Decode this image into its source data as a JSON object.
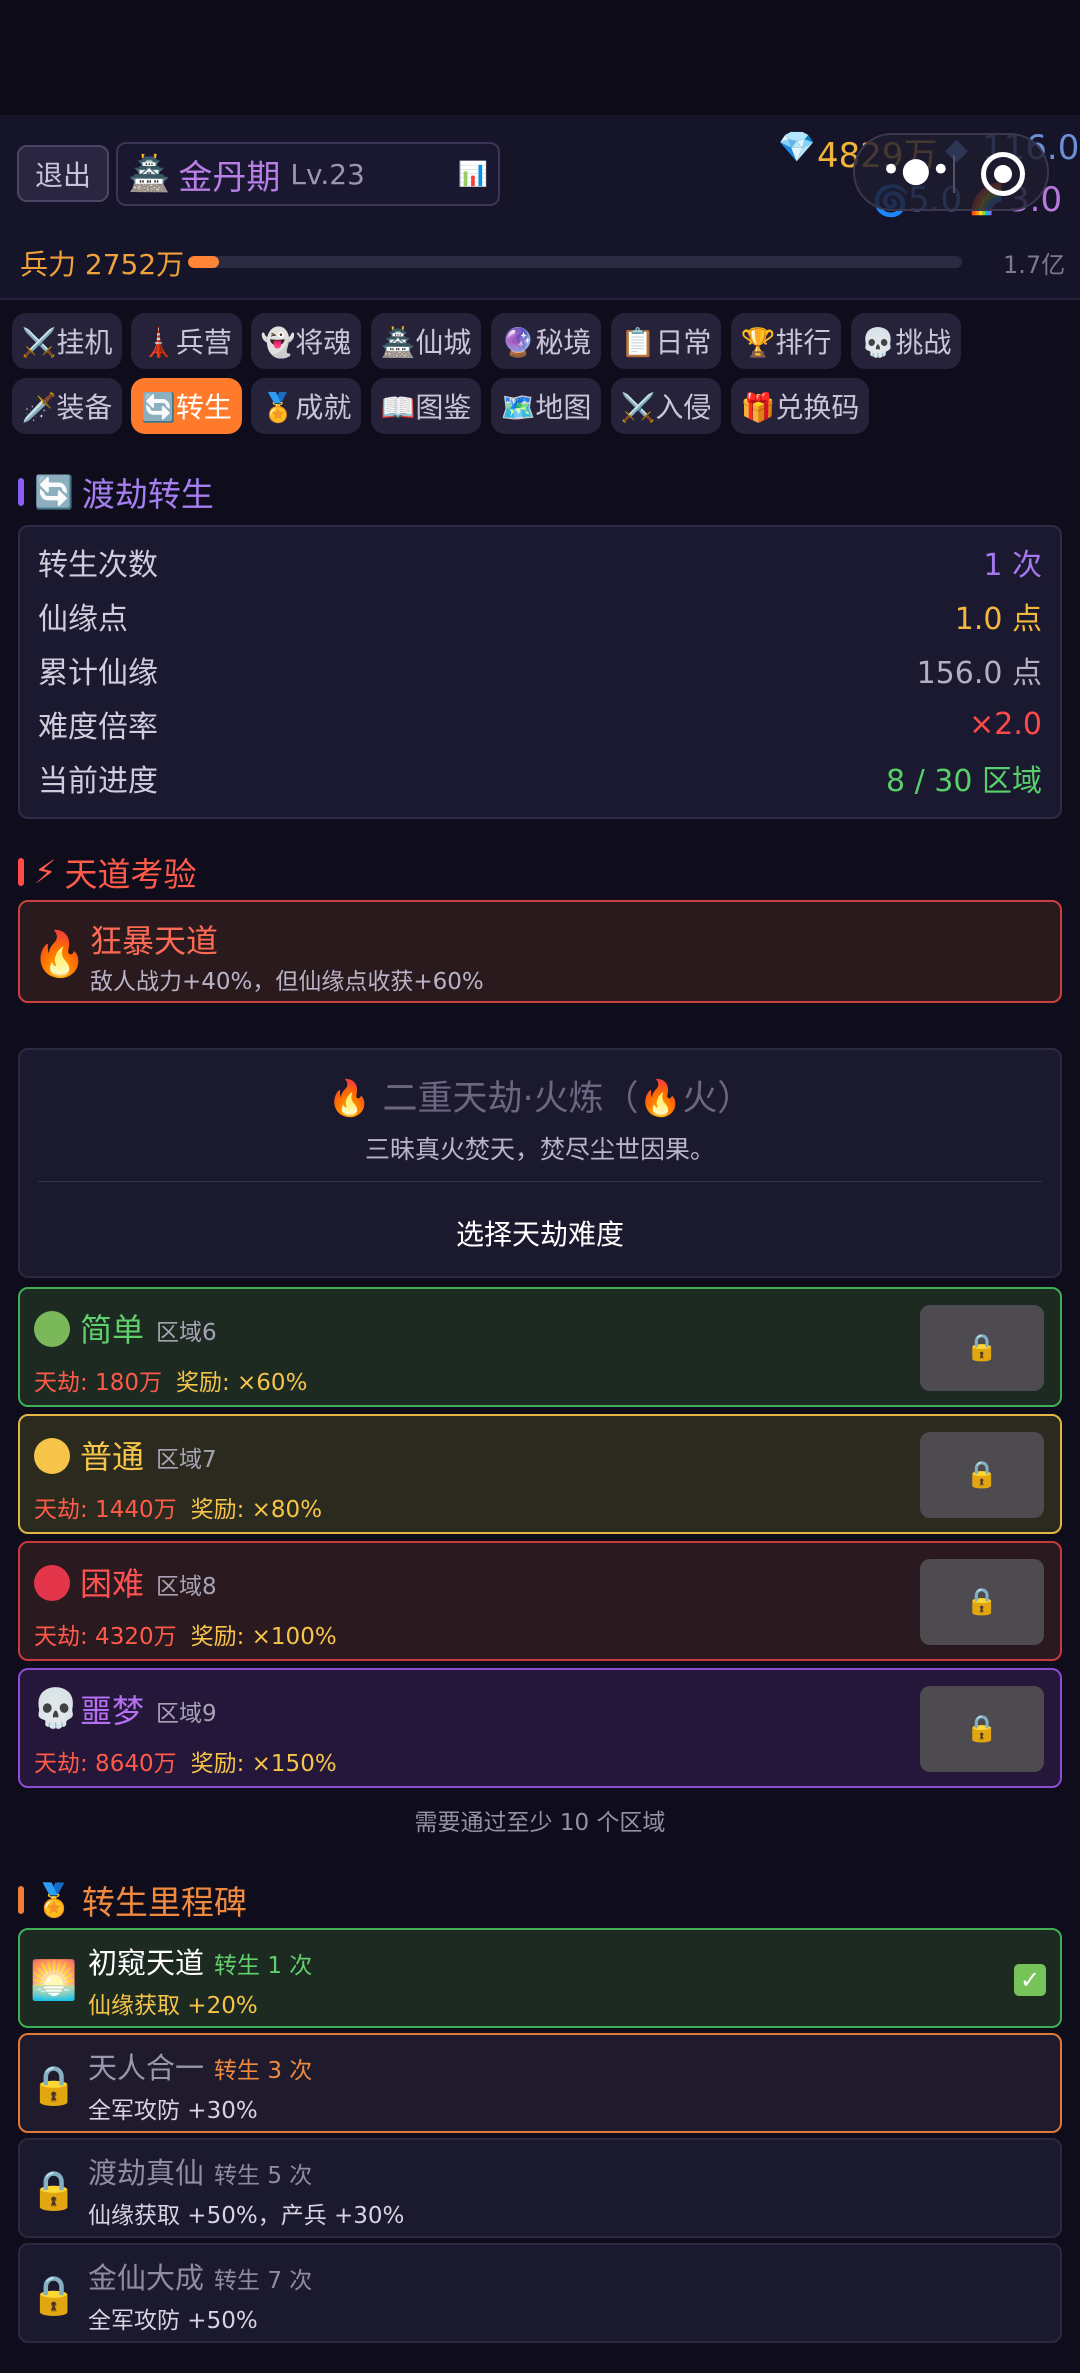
{
  "header": {
    "exit_label": "退出",
    "realm_name": "金丹期",
    "realm_level": "Lv.23",
    "gold": "4829万",
    "crystal": "116.0",
    "swirl": "5.0",
    "rainbow": "3.0",
    "power_label": "兵力 2752万",
    "power_fraction": 0.04,
    "power_max": "1.7亿"
  },
  "tabs_row1": [
    {
      "label": "⚔️挂机"
    },
    {
      "label": "🗼兵营"
    },
    {
      "label": "👻将魂"
    },
    {
      "label": "🏯仙城"
    },
    {
      "label": "🔮秘境",
      "dot": true
    },
    {
      "label": "📋日常"
    },
    {
      "label": "🏆排行"
    },
    {
      "label": "💀挑战",
      "dot": true
    }
  ],
  "tabs_row2": [
    {
      "label": "🗡️装备"
    },
    {
      "label": "🔄转生",
      "active": true
    },
    {
      "label": "🏅成就"
    },
    {
      "label": "📖图鉴"
    },
    {
      "label": "🗺️地图"
    },
    {
      "label": "⚔️入侵"
    },
    {
      "label": "🎁兑换码"
    }
  ],
  "rebirth": {
    "title": "渡劫转生",
    "rows": [
      {
        "key": "转生次数",
        "value": "1 次",
        "color": "#a678f0"
      },
      {
        "key": "仙缘点",
        "value": "1.0 点",
        "color": "#f5b73b"
      },
      {
        "key": "累计仙缘",
        "value": "156.0 点",
        "color": "#b3afc2"
      },
      {
        "key": "难度倍率",
        "value": "×2.0",
        "color": "#ff4a4a"
      },
      {
        "key": "当前进度",
        "value": "8 / 30 区域",
        "color": "#58d06a"
      }
    ]
  },
  "trial": {
    "title": "天道考验",
    "name": "狂暴天道",
    "desc": "敌人战力+40%，但仙缘点收获+60%"
  },
  "calamity": {
    "title": "🔥 二重天劫·火炼（🔥火）",
    "subtitle": "三昧真火焚天，焚尽尘世因果。",
    "choose_label": "选择天劫难度"
  },
  "difficulties": [
    {
      "name": "简单",
      "zone": "区域6",
      "tianjie": "天劫: 180万",
      "reward": "奖励: ×60%",
      "border": "#3fae55",
      "bg": "#1c2a22",
      "color": "#5fd06b",
      "dot": "#7bb85a"
    },
    {
      "name": "普通",
      "zone": "区域7",
      "tianjie": "天劫: 1440万",
      "reward": "奖励: ×80%",
      "border": "#e1b643",
      "bg": "#2b2a1e",
      "color": "#f6c448",
      "dot": "#f6c448"
    },
    {
      "name": "困难",
      "zone": "区域8",
      "tianjie": "天劫: 4320万",
      "reward": "奖励: ×100%",
      "border": "#c73b3f",
      "bg": "#2a1a20",
      "color": "#ff5252",
      "dot": "#e4364a"
    },
    {
      "name": "噩梦",
      "zone": "区域9",
      "tianjie": "天劫: 8640万",
      "reward": "奖励: ×150%",
      "border": "#8a4ed1",
      "bg": "#24173a",
      "color": "#b470f0",
      "skull": "💀"
    }
  ],
  "lock_icon": "🔒",
  "requirement": "需要通过至少 10 个区域",
  "milestones": {
    "title": "转生里程碑",
    "items": [
      {
        "icon": "🌅",
        "name": "初窥天道",
        "times": "转生 1 次",
        "desc": "仙缘获取 +20%",
        "done": true,
        "border": "#3fae55",
        "bg": "#1c2a22",
        "ncolor": "#ffffff",
        "tcolor": "#5fd06b",
        "dcolor": "#f6c448"
      },
      {
        "icon": "🔒",
        "name": "天人合一",
        "times": "转生 3 次",
        "desc": "全军攻防 +30%",
        "done": false,
        "border": "#e07a3a",
        "bg": "#1f1a2c",
        "ncolor": "#9a96ad",
        "tcolor": "#f08a3e",
        "dcolor": "#d7d3e2"
      },
      {
        "icon": "🔒",
        "name": "渡劫真仙",
        "times": "转生 5 次",
        "desc": "仙缘获取 +50%，产兵 +30%",
        "done": false,
        "border": "#2c2942",
        "bg": "#1b192e",
        "ncolor": "#8f8ba3",
        "tcolor": "#8f8ba3",
        "dcolor": "#d7d3e2"
      },
      {
        "icon": "🔒",
        "name": "金仙大成",
        "times": "转生 7 次",
        "desc": "全军攻防 +50%",
        "done": false,
        "border": "#2c2942",
        "bg": "#1b192e",
        "ncolor": "#8f8ba3",
        "tcolor": "#8f8ba3",
        "dcolor": "#d7d3e2"
      }
    ]
  }
}
